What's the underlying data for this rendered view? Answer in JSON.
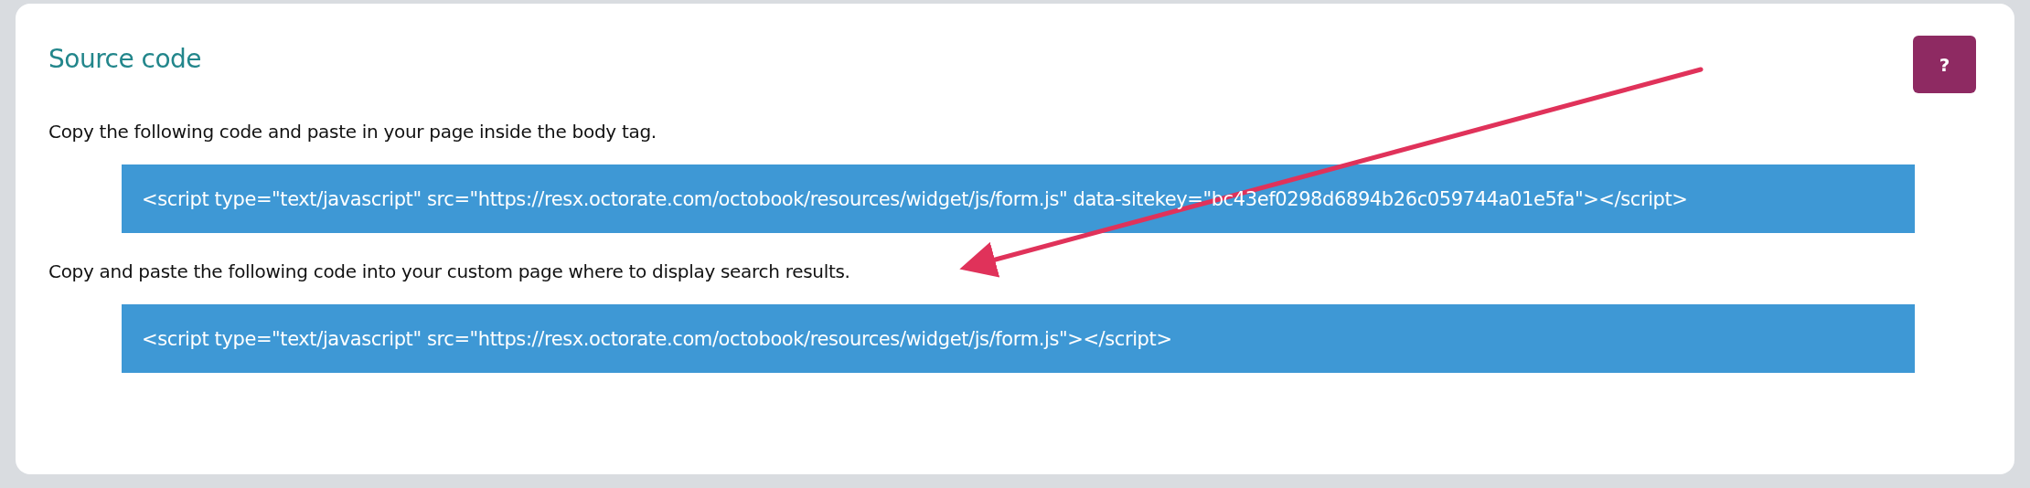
{
  "card": {
    "title": "Source code",
    "help_button": "?",
    "sections": [
      {
        "instruction": "Copy the following code and paste in your page inside the body tag.",
        "code": "<script type=\"text/javascript\" src=\"https://resx.octorate.com/octobook/resources/widget/js/form.js\" data-sitekey=\"bc43ef0298d6894b26c059744a01e5fa\"></script>"
      },
      {
        "instruction": "Copy and paste the following code into your custom page where to display search results.",
        "code": "<script type=\"text/javascript\" src=\"https://resx.octorate.com/octobook/resources/widget/js/form.js\"></script>"
      }
    ]
  }
}
